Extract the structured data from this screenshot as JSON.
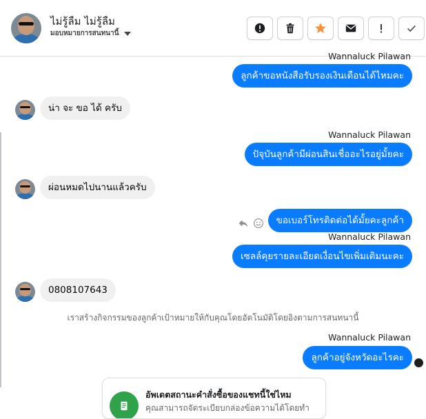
{
  "header": {
    "contact_name": "ไม่รู้ลืม ไม่รู้ลืม",
    "assign_label": "มอบหมายการสนทนานี้",
    "toolbar": [
      {
        "name": "alert-button",
        "icon": "alert-circle-icon",
        "label": ""
      },
      {
        "name": "delete-button",
        "icon": "trash-icon",
        "label": ""
      },
      {
        "name": "star-button",
        "icon": "star-icon",
        "label": ""
      },
      {
        "name": "mark-unread-button",
        "icon": "envelope-icon",
        "label": ""
      },
      {
        "name": "follow-up-button",
        "icon": "exclamation-icon",
        "label": ""
      },
      {
        "name": "mark-done-button",
        "icon": "check-icon",
        "label": ""
      }
    ],
    "colors": {
      "star": "#f7923b",
      "accent": "#0a7cff"
    }
  },
  "messages": [
    {
      "id": "m1",
      "side": "out",
      "sender": "Wannaluck Pilawan",
      "text": "ลูกค้าขอหนังสือรับรองเงินเดือนได้ไหมคะ"
    },
    {
      "id": "m2",
      "side": "in",
      "text": "น่า จะ ขอ ได้ ครับ"
    },
    {
      "id": "m3",
      "side": "out",
      "sender": "Wannaluck Pilawan",
      "text": "ปัจุบันลูกค้ามีผ่อนสินเชื่ออะไรอยู่มั้ยคะ"
    },
    {
      "id": "m4",
      "side": "in",
      "text": "ผ่อนหมดไปนานแล้วครับ"
    },
    {
      "id": "m5",
      "side": "out",
      "text": "ขอเบอร์โทรติดต่อได้มั้ยคะลูกค้า"
    },
    {
      "id": "m6",
      "side": "out",
      "sender": "Wannaluck Pilawan",
      "text": "เซลล์คุยรายละเอียดเงื่อนไขเพิ่มเติมนะคะ"
    },
    {
      "id": "m7",
      "side": "in",
      "text": "0808107643"
    },
    {
      "id": "m8",
      "side": "system",
      "text": "เราสร้างกิจกรรมของลูกค้าเป้าหมายให้กับคุณโดยอัตโนมัติโดยอิงตามการสนทนานี้"
    },
    {
      "id": "m9",
      "side": "out",
      "sender": "Wannaluck Pilawan",
      "text": "ลูกค้าอยู่จังหวัดอะไรคะ"
    }
  ],
  "card": {
    "title": "อัพเดตสถานะคำสั่งซื้อของแชทนี้ใช่ไหม",
    "body": "คุณสามารถจัดระเบียบกล่องข้อความได้โดยทำ",
    "icon": "receipt-icon"
  }
}
